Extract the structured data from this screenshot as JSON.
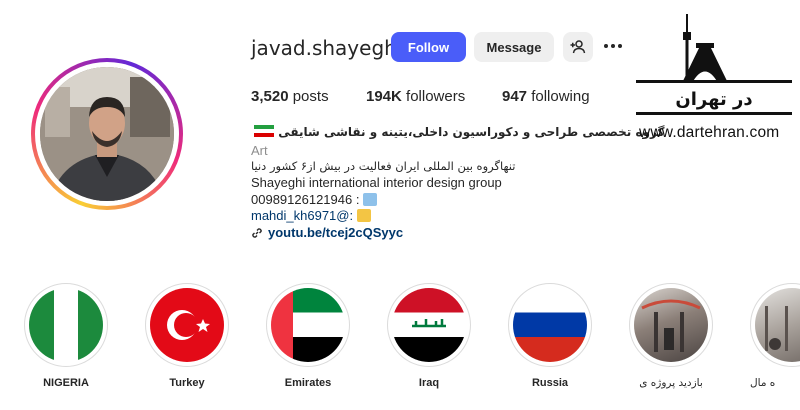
{
  "profile": {
    "username": "javad.shayeghi",
    "follow_label": "Follow",
    "message_label": "Message",
    "add_user_icon": "add-user-icon",
    "more_icon": "more-options-icon"
  },
  "stats": {
    "posts_count": "3,520",
    "posts_label": "posts",
    "followers_count": "194K",
    "followers_label": "followers",
    "following_count": "947",
    "following_label": "following"
  },
  "bio": {
    "title": "گروه تخصصی طراحی و دکوراسیون داخلی،یتینه و نقاشی شایقی",
    "category": "Art",
    "line_fa": "تنهاگروه بین المللی ایران فعالیت در بیش از۶ کشور دنیا",
    "line_en": "Shayeghi international interior design group",
    "phone": "00989126121946 :",
    "mention": "mahdi_kh6971@:",
    "link": "youtu.be/tcej2cQSyyc"
  },
  "logo": {
    "text": "در تهران",
    "website": "www.dartehran.com"
  },
  "highlights": [
    {
      "label": "NIGERIA"
    },
    {
      "label": "Turkey"
    },
    {
      "label": "Emirates"
    },
    {
      "label": "Iraq"
    },
    {
      "label": "Russia"
    },
    {
      "label": "بازدید پروژه ی"
    },
    {
      "label": "ه مال"
    }
  ],
  "colors": {
    "follow_button": "#4a5df9",
    "link": "#00376b",
    "secondary_text": "#8e8e8e"
  }
}
